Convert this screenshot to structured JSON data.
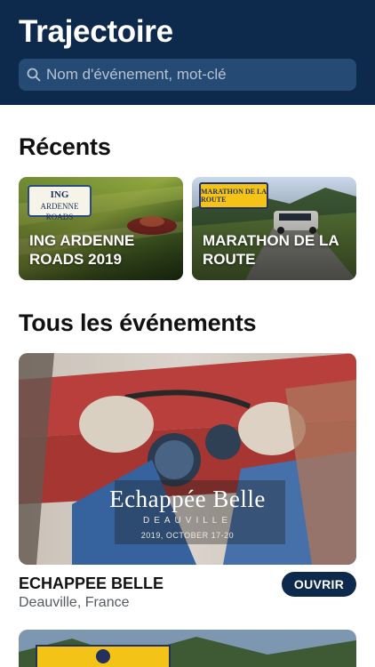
{
  "app": {
    "title": "Trajectoire"
  },
  "search": {
    "placeholder": "Nom d'événement, mot-clé"
  },
  "sections": {
    "recent_title": "Récents",
    "all_title": "Tous les événements"
  },
  "recents": [
    {
      "label": "ING ARDENNE ROADS 2019",
      "badge_line1": "ING",
      "badge_line2": "ARDENNE ROADS"
    },
    {
      "label": "MARATHON DE LA ROUTE",
      "badge": "MARATHON DE LA ROUTE"
    }
  ],
  "featured": {
    "brand": "Echappée Belle",
    "subtitle": "DEAUVILLE",
    "date": "2019, OCTOBER 17-20",
    "title": "ECHAPPEE BELLE",
    "location": "Deauville, France",
    "button_label": "OUVRIR"
  },
  "colors": {
    "header": "#0d2a4c",
    "search_bg": "#254a73",
    "accent": "#0d2a4c",
    "badge_yellow": "#f3c318"
  }
}
